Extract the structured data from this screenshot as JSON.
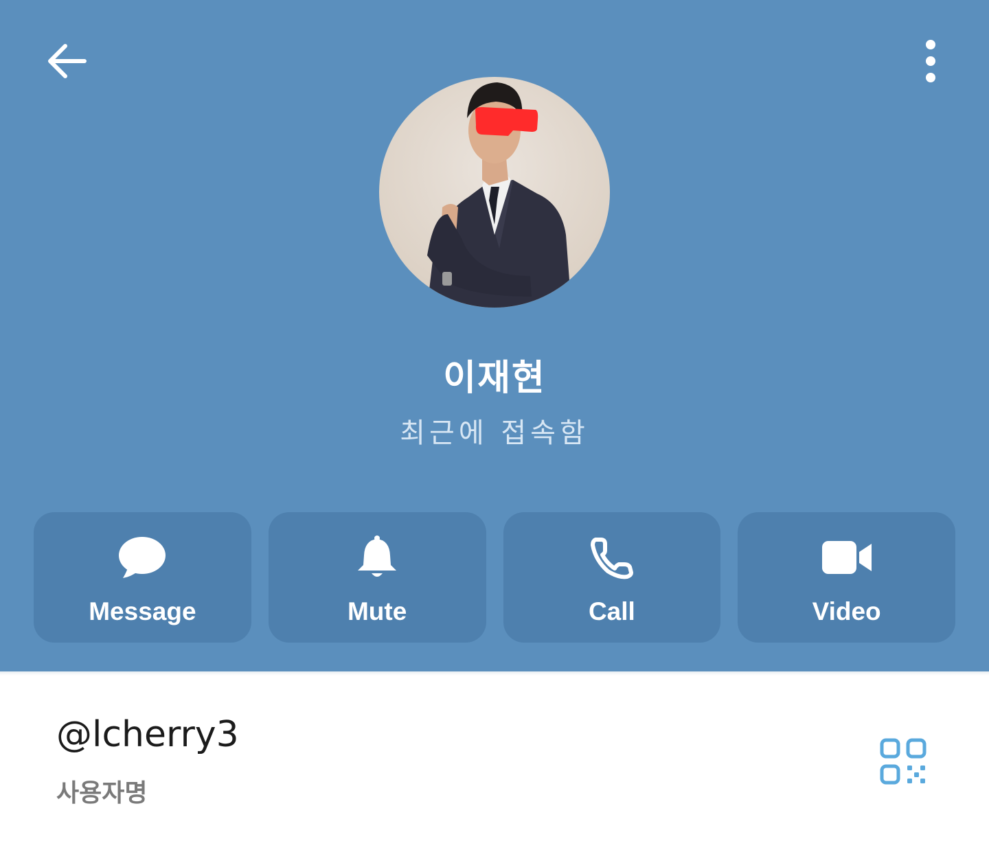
{
  "header": {
    "back_icon": "arrow-left-icon",
    "more_icon": "more-vertical-icon",
    "background_color": "#5b8fbd"
  },
  "profile": {
    "name": "이재현",
    "status": "최근에 접속함"
  },
  "actions": [
    {
      "label": "Message",
      "icon": "message-bubble-icon"
    },
    {
      "label": "Mute",
      "icon": "bell-icon"
    },
    {
      "label": "Call",
      "icon": "phone-icon"
    },
    {
      "label": "Video",
      "icon": "video-camera-icon"
    }
  ],
  "info": {
    "username": "@lcherry3",
    "username_label": "사용자명",
    "qr_icon": "qr-code-icon",
    "qr_color": "#5aa9dd"
  }
}
